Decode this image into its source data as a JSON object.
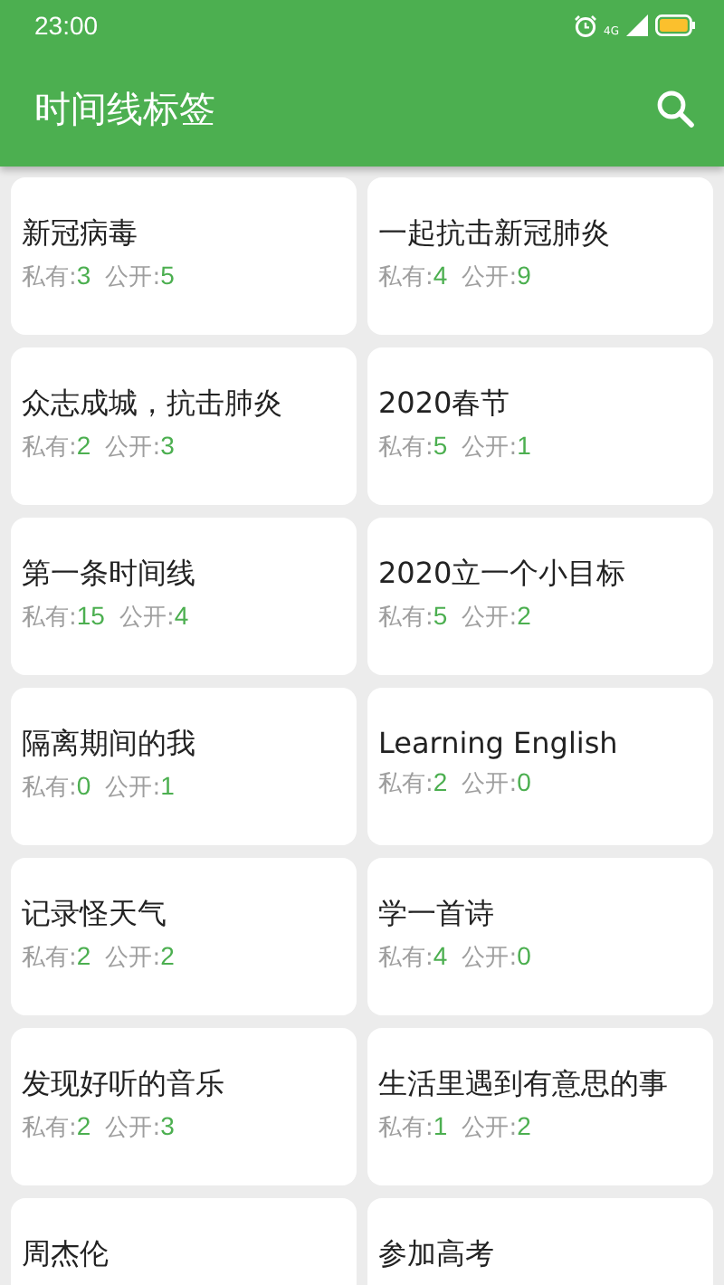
{
  "status_bar": {
    "time": "23:00",
    "network": "4G"
  },
  "app_bar": {
    "title": "时间线标签"
  },
  "tags": [
    {
      "title": "新冠病毒",
      "private_label": "私有:",
      "private": "3",
      "public_label": "公开:",
      "public": "5"
    },
    {
      "title": "一起抗击新冠肺炎",
      "private_label": "私有:",
      "private": "4",
      "public_label": "公开:",
      "public": "9"
    },
    {
      "title": "众志成城，抗击肺炎",
      "private_label": "私有:",
      "private": "2",
      "public_label": "公开:",
      "public": "3"
    },
    {
      "title": "2020春节",
      "private_label": "私有:",
      "private": "5",
      "public_label": "公开:",
      "public": "1"
    },
    {
      "title": "第一条时间线",
      "private_label": "私有:",
      "private": "15",
      "public_label": "公开:",
      "public": "4"
    },
    {
      "title": "2020立一个小目标",
      "private_label": "私有:",
      "private": "5",
      "public_label": "公开:",
      "public": "2"
    },
    {
      "title": "隔离期间的我",
      "private_label": "私有:",
      "private": "0",
      "public_label": "公开:",
      "public": "1"
    },
    {
      "title": "Learning English",
      "private_label": "私有:",
      "private": "2",
      "public_label": "公开:",
      "public": "0"
    },
    {
      "title": "记录怪天气",
      "private_label": "私有:",
      "private": "2",
      "public_label": "公开:",
      "public": "2"
    },
    {
      "title": "学一首诗",
      "private_label": "私有:",
      "private": "4",
      "public_label": "公开:",
      "public": "0"
    },
    {
      "title": "发现好听的音乐",
      "private_label": "私有:",
      "private": "2",
      "public_label": "公开:",
      "public": "3"
    },
    {
      "title": "生活里遇到有意思的事",
      "private_label": "私有:",
      "private": "1",
      "public_label": "公开:",
      "public": "2"
    },
    {
      "title": "周杰伦"
    },
    {
      "title": "参加高考"
    }
  ]
}
